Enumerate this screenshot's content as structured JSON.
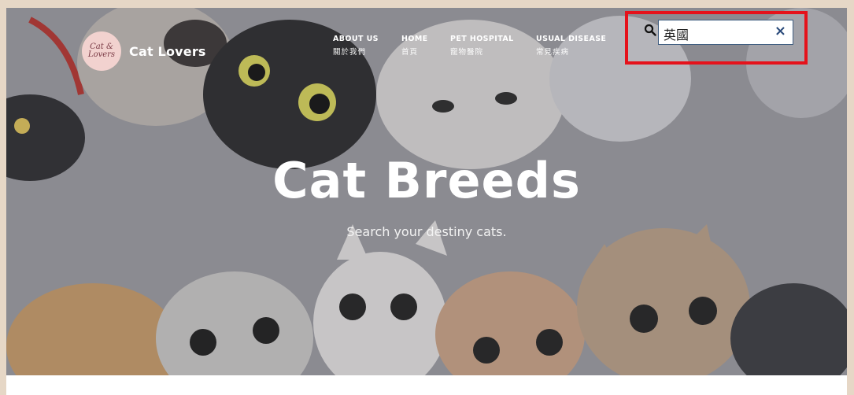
{
  "brand": {
    "logo_text": "Cat & Lovers",
    "name": "Cat Lovers"
  },
  "nav": [
    {
      "en": "ABOUT US",
      "zh": "關於我們"
    },
    {
      "en": "HOME",
      "zh": "首頁"
    },
    {
      "en": "PET HOSPITAL",
      "zh": "寵物醫院"
    },
    {
      "en": "USUAL DISEASE",
      "zh": "常見疾病"
    }
  ],
  "search": {
    "value": "英國",
    "clear_symbol": "×"
  },
  "hero": {
    "title": "Cat Breeds",
    "subtitle": "Search your destiny cats."
  },
  "colors": {
    "highlight_border": "#e5121b",
    "page_frame": "#e6d7c6"
  }
}
